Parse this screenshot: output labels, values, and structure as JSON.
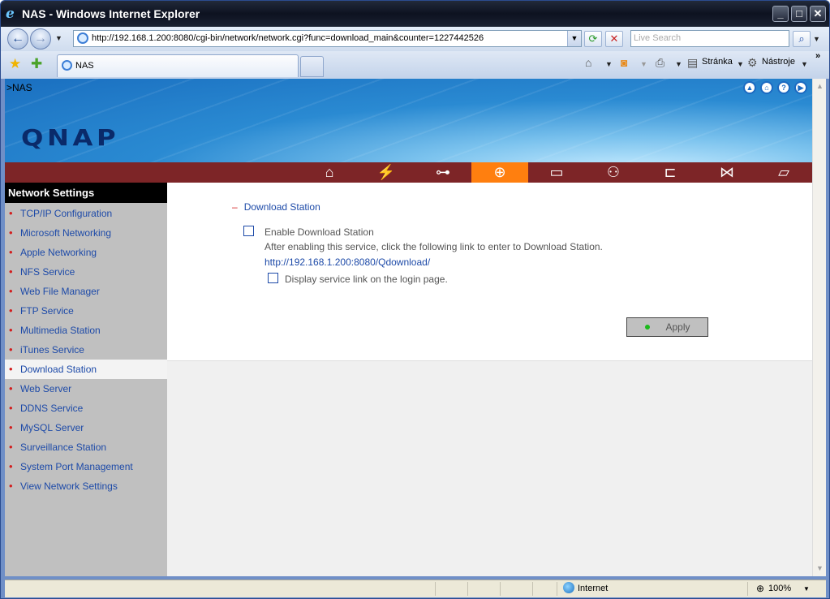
{
  "window": {
    "title": "NAS - Windows Internet Explorer"
  },
  "browser": {
    "url": "http://192.168.1.200:8080/cgi-bin/network/network.cgi?func=download_main&counter=1227442526",
    "search_placeholder": "Live Search",
    "tab_label": "NAS",
    "stranka_label": "Stránka",
    "nastroje_label": "Nástroje",
    "zone_label": "Internet",
    "zoom_label": "100%"
  },
  "page": {
    "breadcrumb": ">NAS",
    "logo": "QNAP",
    "sidebar_title": "Network Settings",
    "sidebar_items": [
      "TCP/IP Configuration",
      "Microsoft Networking",
      "Apple Networking",
      "NFS Service",
      "Web File Manager",
      "FTP Service",
      "Multimedia Station",
      "iTunes Service",
      "Download Station",
      "Web Server",
      "DDNS Service",
      "MySQL Server",
      "Surveillance Station",
      "System Port Management",
      "View Network Settings"
    ],
    "active_item": "Download Station",
    "section_title": "Download Station",
    "enable_label": "Enable Download Station",
    "enable_desc": "After enabling this service, click the following link to enter to Download Station.",
    "download_link": "http://192.168.1.200:8080/Qdownload/",
    "login_link_label": "Display service link on the login page.",
    "apply_label": "Apply"
  },
  "colors": {
    "menubar": "#7d2527",
    "menu_active": "#ff7f0f",
    "link": "#1d4aa8",
    "bullet": "#d21e1e"
  }
}
